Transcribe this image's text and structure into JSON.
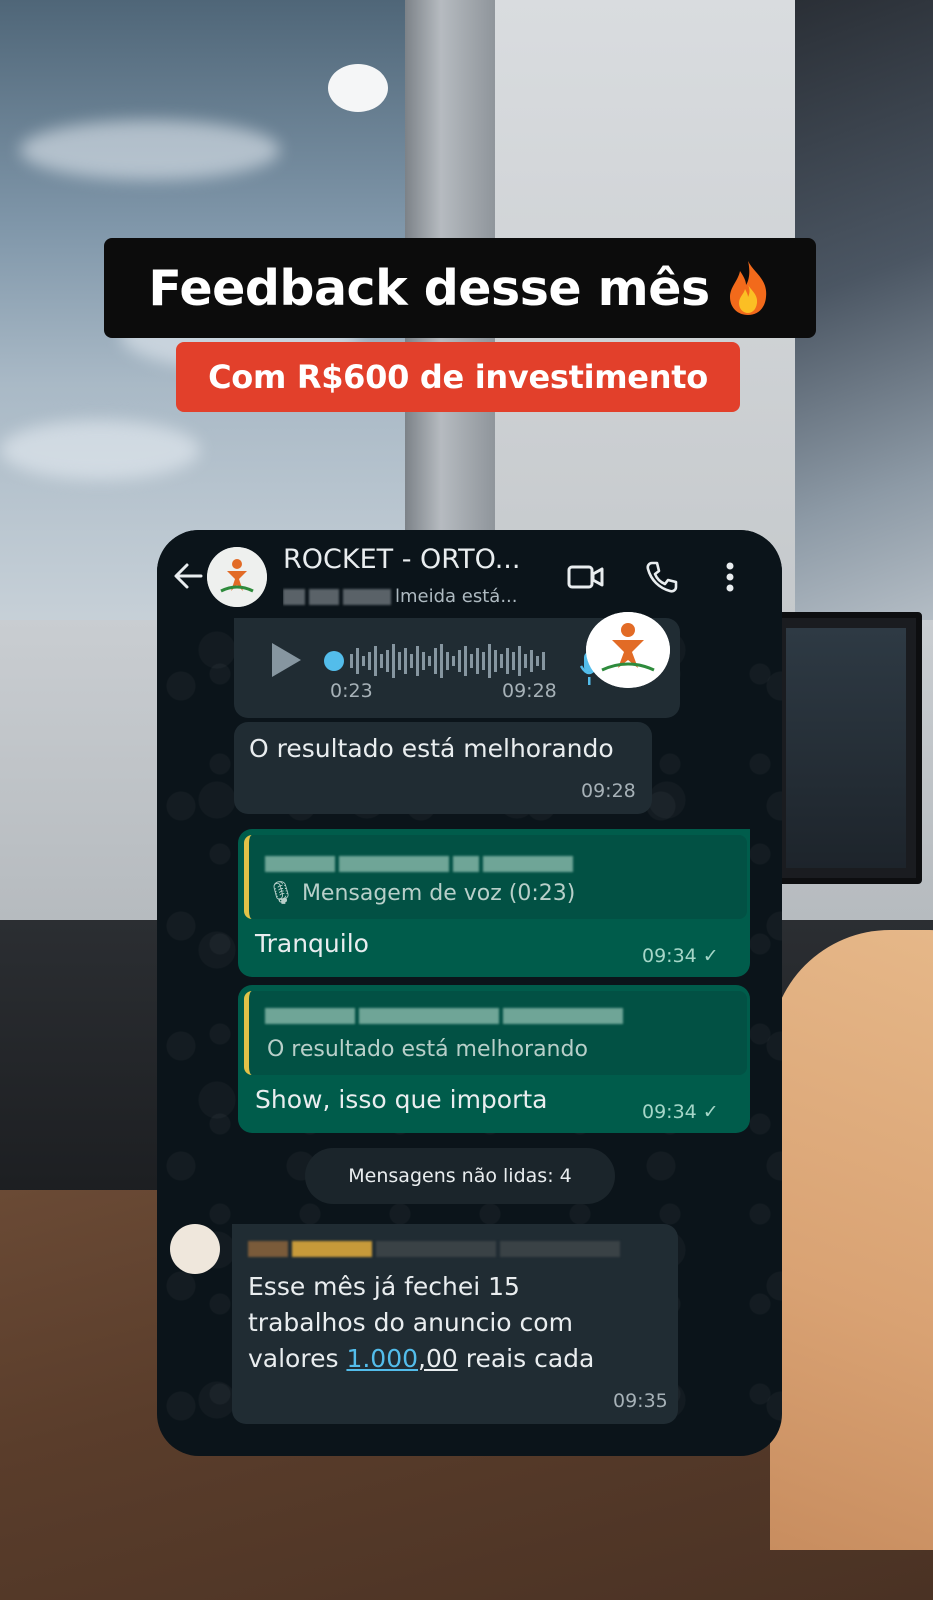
{
  "overlay": {
    "headline": "Feedback desse mês",
    "headline_emoji": "fire-icon",
    "subhead": "Com R$600 de investimento"
  },
  "chat": {
    "title": "ROCKET - ORTO...",
    "subtitle": "lmeida está...",
    "colors": {
      "incoming": "#202c33",
      "outgoing": "#005c4b",
      "background": "#0b141a",
      "link": "#53bdeb"
    },
    "messages": {
      "voice": {
        "duration": "0:23",
        "time": "09:28"
      },
      "in_1": {
        "text": "O resultado está melhorando",
        "time": "09:28"
      },
      "out_1": {
        "quote_text": "Mensagem de voz (0:23)",
        "text": "Tranquilo",
        "time": "09:34 ✓"
      },
      "out_2": {
        "quote_text": "O resultado está melhorando",
        "text": "Show, isso que importa",
        "time": "09:34 ✓"
      },
      "unread": "Mensagens não lidas: 4",
      "in_2": {
        "line1": "Esse mês já fechei 15",
        "line2": "trabalhos do anuncio com",
        "line3_pre": "valores ",
        "line3_link": "1.000",
        "line3_und": ",00",
        "line3_post": " reais cada",
        "time": "09:35"
      }
    }
  }
}
